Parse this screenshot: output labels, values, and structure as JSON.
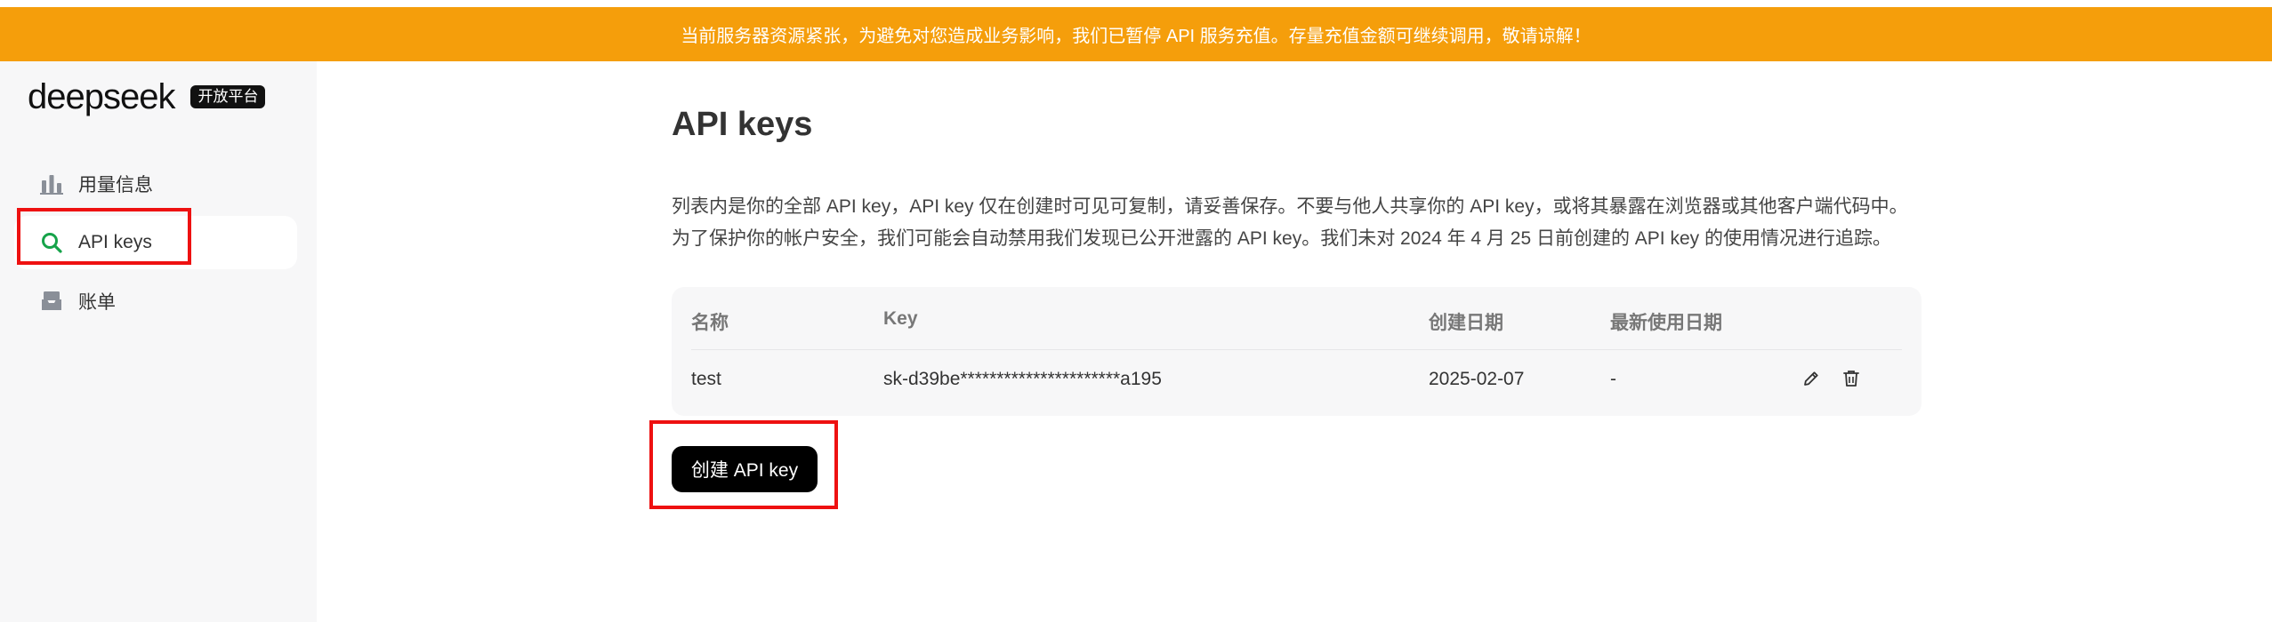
{
  "banner": {
    "text": "当前服务器资源紧张，为避免对您造成业务影响，我们已暂停 API 服务充值。存量充值金额可继续调用，敬请谅解！",
    "color": "#f59e0b"
  },
  "sidebar": {
    "brand": "deepseek",
    "badge": "开放平台",
    "items": [
      {
        "label": "用量信息",
        "icon": "bar-chart-icon"
      },
      {
        "label": "API keys",
        "icon": "search-icon",
        "active": true
      },
      {
        "label": "账单",
        "icon": "inbox-icon"
      }
    ]
  },
  "main": {
    "title": "API keys",
    "description_line1": "列表内是你的全部 API key，API key 仅在创建时可见可复制，请妥善保存。不要与他人共享你的 API key，或将其暴露在浏览器或其他客户端代码中。",
    "description_line2": "为了保护你的帐户安全，我们可能会自动禁用我们发现已公开泄露的 API key。我们未对 2024 年 4 月 25 日前创建的 API key 的使用情况进行追踪。",
    "table": {
      "headers": [
        "名称",
        "Key",
        "创建日期",
        "最新使用日期"
      ],
      "rows": [
        {
          "name": "test",
          "key": "sk-d39be**********************a195",
          "created": "2025-02-07",
          "last_used": "-",
          "actions": [
            "edit-icon",
            "trash-icon"
          ]
        }
      ]
    },
    "create_button": "创建 API key"
  },
  "colors": {
    "accent_active_icon": "#16a34a",
    "annotation": "#ee1111"
  }
}
